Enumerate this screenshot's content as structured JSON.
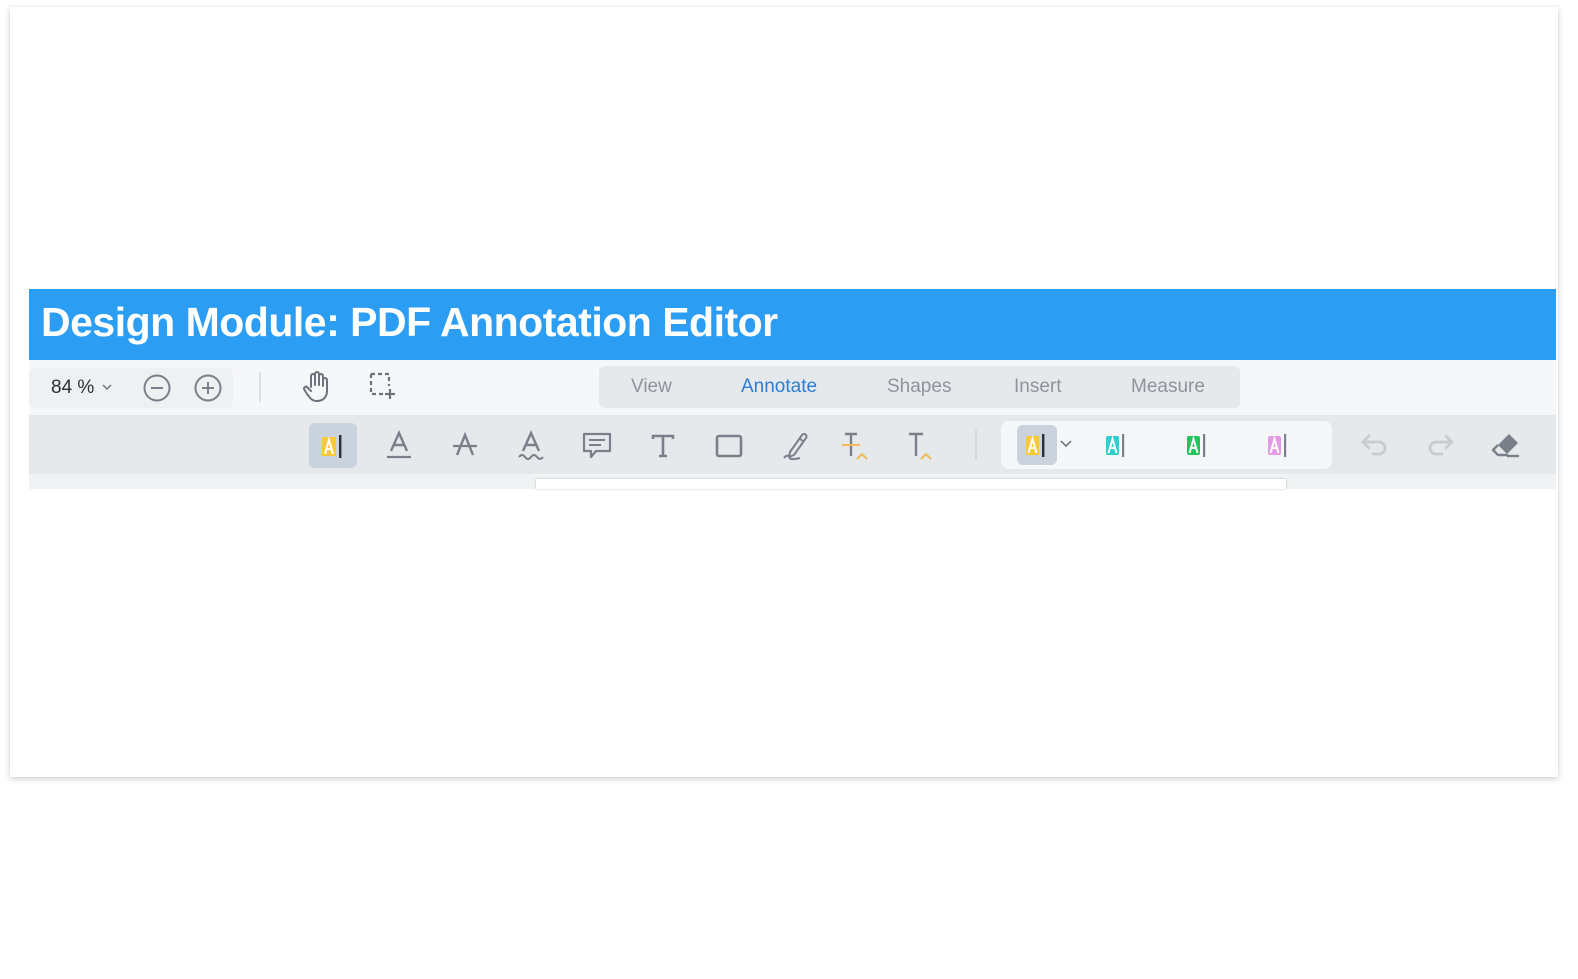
{
  "header": {
    "title": "Design Module: PDF Annotation Editor"
  },
  "view_toolbar": {
    "zoom_level": "84 %",
    "zoom_dropdown_icon": "chevron-down-icon",
    "zoom_out_icon": "minus-circle-icon",
    "zoom_in_icon": "plus-circle-icon",
    "pan_tool_icon": "hand-icon",
    "marquee_select_icon": "dashed-selection-plus-icon",
    "tabs": [
      {
        "label": "View",
        "active": false
      },
      {
        "label": "Annotate",
        "active": true
      },
      {
        "label": "Shapes",
        "active": false
      },
      {
        "label": "Insert",
        "active": false
      },
      {
        "label": "Measure",
        "active": false
      }
    ]
  },
  "annotate_toolbar": {
    "tools": [
      {
        "name": "highlight",
        "icon": "highlight-text-icon",
        "active": true
      },
      {
        "name": "underline",
        "icon": "underline-text-icon",
        "active": false
      },
      {
        "name": "strikeout",
        "icon": "strikeout-text-icon",
        "active": false
      },
      {
        "name": "squiggly",
        "icon": "squiggly-underline-icon",
        "active": false
      },
      {
        "name": "comment",
        "icon": "comment-icon",
        "active": false
      },
      {
        "name": "free-text",
        "icon": "text-icon",
        "active": false
      },
      {
        "name": "rectangle",
        "icon": "rectangle-icon",
        "active": false
      },
      {
        "name": "freehand",
        "icon": "pen-icon",
        "active": false
      },
      {
        "name": "replace-text",
        "icon": "replace-text-icon",
        "active": false
      },
      {
        "name": "insert-text",
        "icon": "insert-text-icon",
        "active": false
      }
    ],
    "highlight_colors": [
      {
        "name": "yellow",
        "color": "#f9c93a",
        "active": true
      },
      {
        "name": "cyan",
        "color": "#2ecfcf",
        "active": false
      },
      {
        "name": "green",
        "color": "#1fc45a",
        "active": false
      },
      {
        "name": "pink",
        "color": "#e59ae6",
        "active": false
      }
    ],
    "undo_icon": "undo-icon",
    "redo_icon": "redo-icon",
    "eraser_icon": "eraser-icon",
    "colors": {
      "icon_gray": "#7a8089",
      "disabled_gray": "#c8ccd1",
      "accent_orange": "#f5b85a",
      "active_tab": "#2a7fd4",
      "header_blue": "#2b9ef4"
    }
  }
}
